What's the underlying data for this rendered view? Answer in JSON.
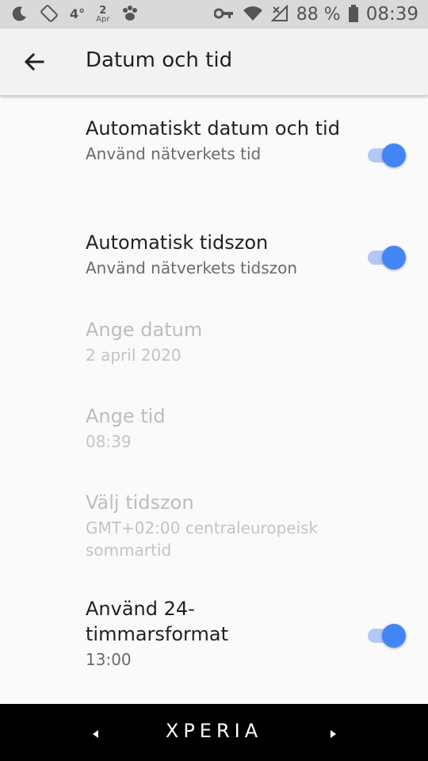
{
  "status_bar": {
    "left_icons": [
      "moon-icon",
      "rotate-icon",
      "temperature-icon",
      "calendar-icon",
      "paw-icon"
    ],
    "temperature": "4°",
    "date_day": "2",
    "date_month": "Apr",
    "right_icons": [
      "key-icon",
      "wifi-icon",
      "no-signal-icon",
      "battery-icon"
    ],
    "battery": "88 %",
    "time": "08:39"
  },
  "app_bar": {
    "title": "Datum och tid"
  },
  "settings": [
    {
      "title": "Automatiskt datum och tid",
      "summary": "Använd nätverkets tid",
      "toggle": true,
      "enabled": true
    },
    {
      "title": "Automatisk tidszon",
      "summary": "Använd nätverkets tidszon",
      "toggle": true,
      "enabled": true
    },
    {
      "title": "Ange datum",
      "summary": "2 april 2020",
      "toggle": false,
      "enabled": false
    },
    {
      "title": "Ange tid",
      "summary": "08:39",
      "toggle": false,
      "enabled": false
    },
    {
      "title": "Välj tidszon",
      "summary": "GMT+02:00 centraleuropeisk sommartid",
      "toggle": false,
      "enabled": false
    },
    {
      "title": "Använd 24-timmarsformat",
      "summary": "13:00",
      "toggle": true,
      "enabled": true
    }
  ],
  "nav_bar": {
    "brand": "XPERIA"
  },
  "colors": {
    "accent": "#4285f4",
    "track": "#b3c9f5"
  }
}
